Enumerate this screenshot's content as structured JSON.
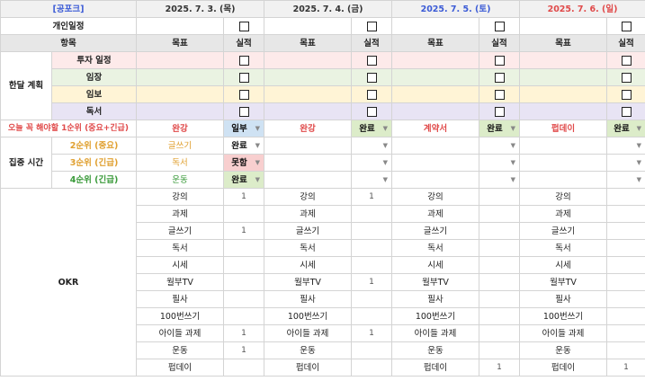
{
  "header": {
    "tag": "[공포크]",
    "dates": [
      {
        "label": "2025. 7. 3. (목)",
        "color": "#333333"
      },
      {
        "label": "2025. 7. 4. (금)",
        "color": "#333333"
      },
      {
        "label": "2025. 7. 5. (토)",
        "color": "#3b5bd6"
      },
      {
        "label": "2025. 7. 6. (일)",
        "color": "#e04a4a"
      }
    ]
  },
  "personal_label": "개인일정",
  "columns": {
    "item": "항목",
    "goal": "목표",
    "result": "실적"
  },
  "monthly": {
    "label": "한달 계획",
    "rows": [
      {
        "name": "투자 일정",
        "bg": "#fdeaea"
      },
      {
        "name": "임장",
        "bg": "#eaf3e2"
      },
      {
        "name": "임보",
        "bg": "#fff4d6"
      },
      {
        "name": "독서",
        "bg": "#e8e4f4"
      }
    ]
  },
  "today_label": "오늘 꼭 해야할 1순위 (중요+긴급)",
  "today_label_color": "#e04a4a",
  "today": [
    {
      "goal": "완강",
      "result": "일부",
      "result_bg": "#cfe2f3"
    },
    {
      "goal": "완강",
      "result": "완료",
      "result_bg": "#dcecc9"
    },
    {
      "goal": "계약서",
      "result": "완료",
      "result_bg": "#dcecc9"
    },
    {
      "goal": "펍데이",
      "result": "완료",
      "result_bg": "#dcecc9"
    }
  ],
  "focus": {
    "label": "집중 시간",
    "priorities": [
      {
        "label": "2순위 (중요)",
        "color": "#e0a030"
      },
      {
        "label": "3순위 (긴급)",
        "color": "#e0a030"
      },
      {
        "label": "4순위 (긴급)",
        "color": "#3a9a3a"
      }
    ],
    "days": [
      [
        {
          "goal": "글쓰기",
          "goal_color": "#e0a030",
          "result": "완료",
          "result_bg": "#ffffff"
        },
        {
          "goal": "독서",
          "goal_color": "#e0a030",
          "result": "못함",
          "result_bg": "#f8cfcf"
        },
        {
          "goal": "운동",
          "goal_color": "#3a9a3a",
          "result": "완료",
          "result_bg": "#dcecc9"
        }
      ],
      [
        {
          "goal": "",
          "goal_color": "#333333",
          "result": "",
          "result_bg": "#ffffff"
        },
        {
          "goal": "",
          "goal_color": "#333333",
          "result": "",
          "result_bg": "#ffffff"
        },
        {
          "goal": "",
          "goal_color": "#333333",
          "result": "",
          "result_bg": "#ffffff"
        }
      ],
      [
        {
          "goal": "",
          "goal_color": "#333333",
          "result": "",
          "result_bg": "#ffffff"
        },
        {
          "goal": "",
          "goal_color": "#333333",
          "result": "",
          "result_bg": "#ffffff"
        },
        {
          "goal": "",
          "goal_color": "#333333",
          "result": "",
          "result_bg": "#ffffff"
        }
      ],
      [
        {
          "goal": "",
          "goal_color": "#333333",
          "result": "",
          "result_bg": "#ffffff"
        },
        {
          "goal": "",
          "goal_color": "#333333",
          "result": "",
          "result_bg": "#ffffff"
        },
        {
          "goal": "",
          "goal_color": "#333333",
          "result": "",
          "result_bg": "#ffffff"
        }
      ]
    ]
  },
  "okr": {
    "label": "OKR",
    "items": [
      "강의",
      "과제",
      "글쓰기",
      "독서",
      "시세",
      "월부TV",
      "필사",
      "100번쓰기",
      "아이들 과제",
      "운동",
      "펍데이"
    ],
    "values": [
      [
        "1",
        "",
        "1",
        "",
        "",
        "",
        "",
        "",
        "1",
        "1",
        ""
      ],
      [
        "1",
        "",
        "",
        "",
        "",
        "1",
        "",
        "",
        "1",
        "",
        ""
      ],
      [
        "",
        "",
        "",
        "",
        "",
        "",
        "",
        "",
        "",
        "",
        "1"
      ],
      [
        "",
        "",
        "",
        "",
        "",
        "",
        "",
        "",
        "",
        "",
        "1"
      ]
    ]
  }
}
